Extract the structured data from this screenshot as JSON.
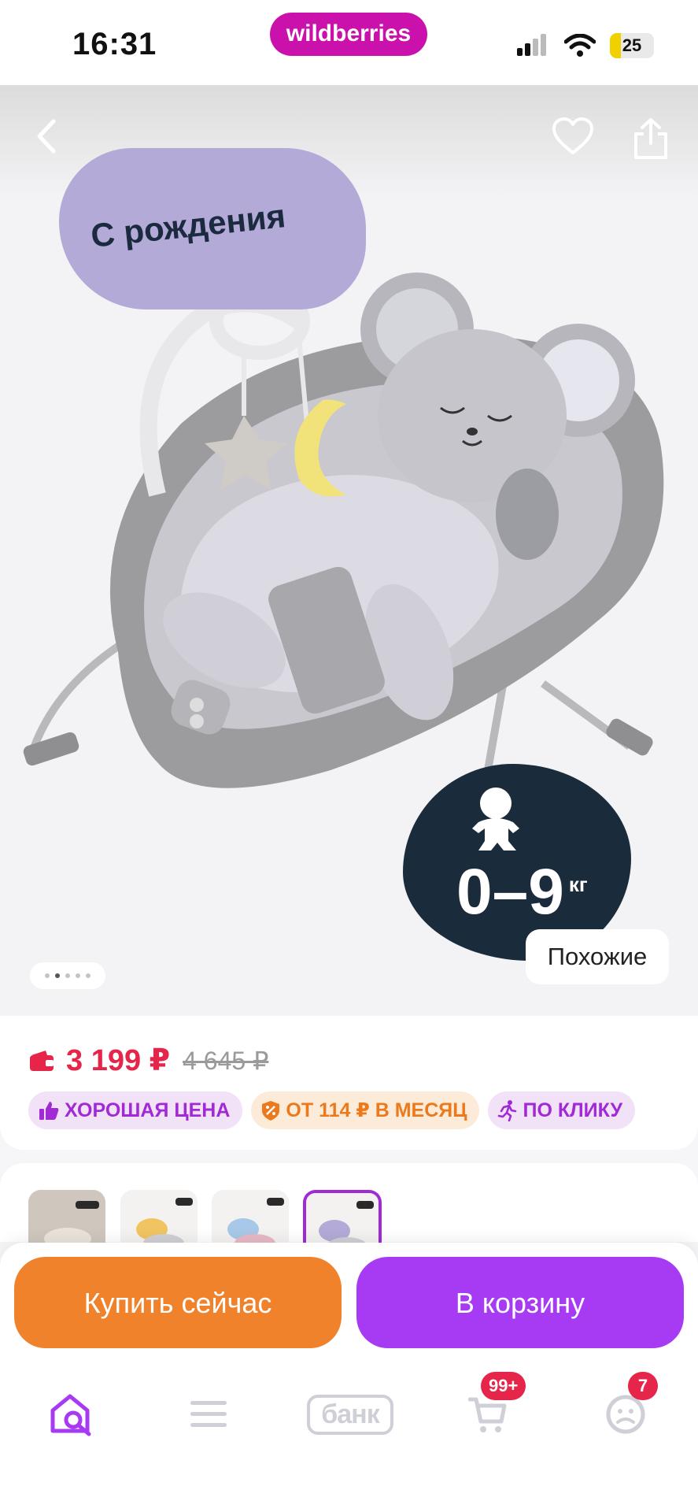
{
  "status_bar": {
    "time": "16:31",
    "brand": "wildberries",
    "battery": "25"
  },
  "gallery": {
    "cloud_label": "С рождения",
    "weight_value": "0–9",
    "weight_unit": "кг",
    "similar_label": "Похожие",
    "dots_count": 5,
    "active_dot": 1
  },
  "price": {
    "current": "3 199 ₽",
    "old": "4 645 ₽"
  },
  "badges": {
    "good_price": "ХОРОШАЯ ЦЕНА",
    "monthly": "ОТ 114 ₽ В МЕСЯЦ",
    "one_click": "ПО КЛИКУ"
  },
  "actions": {
    "buy_now": "Купить сейчас",
    "add_to_cart": "В корзину"
  },
  "tabbar": {
    "bank_label": "банк",
    "cart_badge": "99+",
    "profile_badge": "7"
  },
  "colors": {
    "brand": "#cb11ab",
    "price": "#e5264a",
    "buy": "#f0822c",
    "cart": "#a73af3",
    "accent": "#a12ad6"
  }
}
